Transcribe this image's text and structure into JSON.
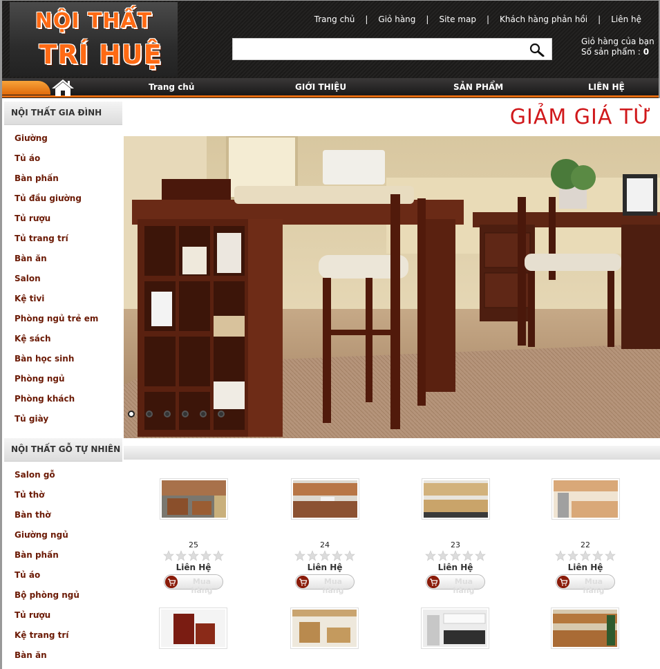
{
  "header": {
    "logo_line1": "NỘI THẤT",
    "logo_line2": "TRÍ HUỆ",
    "top_links": [
      "Trang chủ",
      "Giỏ hàng",
      "Site map",
      "Khách hàng phản hồi",
      "Liên hệ"
    ],
    "link_separator": "|",
    "search": {
      "value": "",
      "placeholder": ""
    },
    "cart": {
      "title": "Giỏ hàng của bạn",
      "count_label": "Số sản phẩm :",
      "count": "0"
    }
  },
  "nav": {
    "items": [
      "Trang chủ",
      "GIỚI THIỆU",
      "SẢN PHẨM",
      "LIÊN HỆ"
    ]
  },
  "sidebar": {
    "categories": [
      {
        "title": "NỘI THẤT GIA ĐÌNH",
        "items": [
          "Giường",
          "Tủ áo",
          "Bàn phấn",
          "Tủ đầu giường",
          "Tủ rượu",
          "Tủ trang trí",
          "Bàn ăn",
          "Salon",
          "Kệ tivi",
          "Phòng ngủ trẻ em",
          "Kệ sách",
          "Bàn học sinh",
          "Phòng ngủ",
          "Phòng khách",
          "Tủ giày"
        ]
      },
      {
        "title": "NỘI THẤT GỖ TỰ NHIÊN",
        "items": [
          "Salon gỗ",
          "Tủ thờ",
          "Bàn thờ",
          "Giường ngủ",
          "Bàn phấn",
          "Tủ áo",
          "Bộ phòng ngủ",
          "Tủ rượu",
          "Kệ trang trí",
          "Bàn ăn"
        ]
      }
    ]
  },
  "promo": {
    "text": "GIẢM GIÁ TỪ"
  },
  "slider": {
    "dot_count": 6,
    "active_index": 0
  },
  "products": [
    {
      "code": "25",
      "price": "Liên Hệ",
      "buy_label": "Mua hàng",
      "rating": 0
    },
    {
      "code": "24",
      "price": "Liên Hệ",
      "buy_label": "Mua hàng",
      "rating": 0
    },
    {
      "code": "23",
      "price": "Liên Hệ",
      "buy_label": "Mua hàng",
      "rating": 0
    },
    {
      "code": "22",
      "price": "Liên Hệ",
      "buy_label": "Mua hàng",
      "rating": 0
    }
  ],
  "colors": {
    "accent": "#e56b0f",
    "link": "#6b1a05",
    "promo": "#d0181b",
    "header_bg": "#1e1d1c"
  },
  "icons": {
    "search": "search-icon",
    "home": "home-icon",
    "cart": "cart-icon",
    "star": "star-icon"
  }
}
